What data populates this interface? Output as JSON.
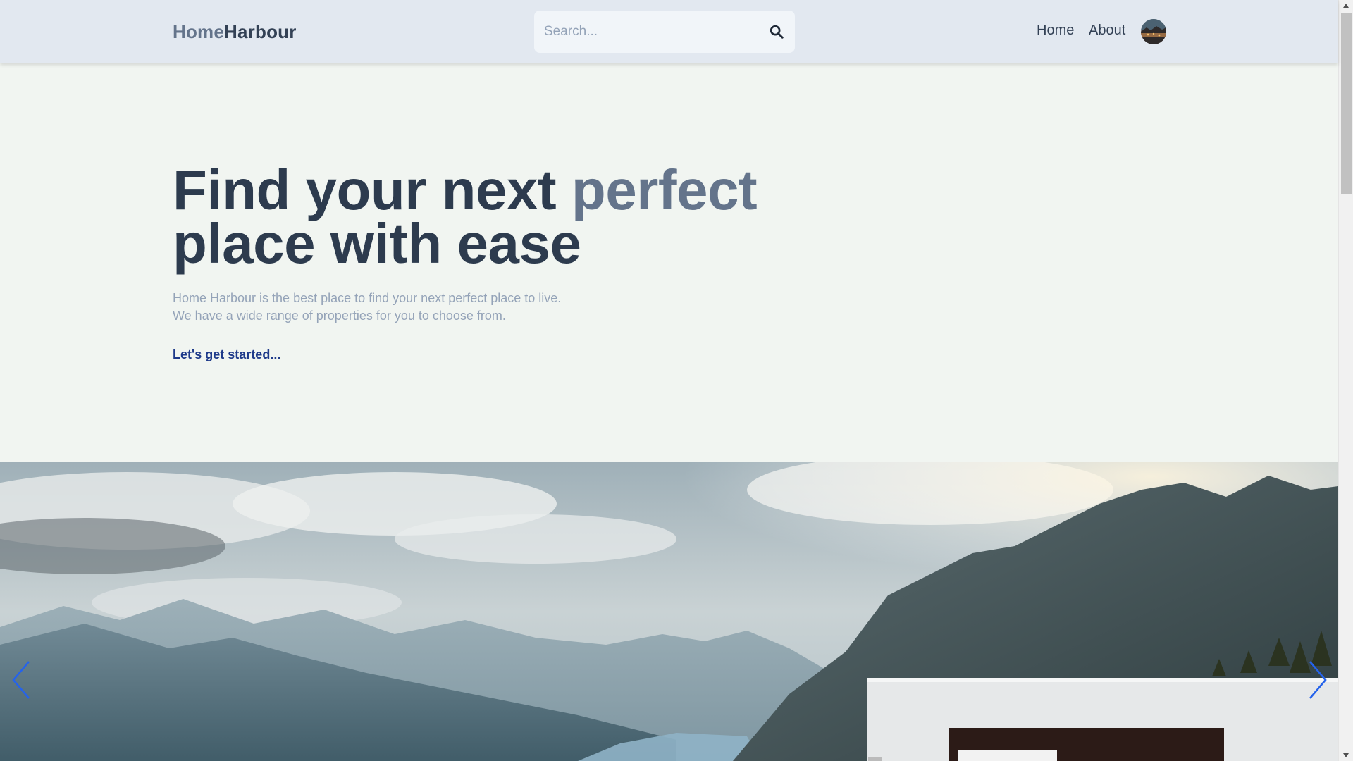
{
  "header": {
    "logo_part1": "Home",
    "logo_part2": "Harbour",
    "search_placeholder": "Search...",
    "search_icon": "search-icon",
    "nav": [
      {
        "label": "Home"
      },
      {
        "label": "About"
      }
    ],
    "avatar_icon": "user-avatar"
  },
  "hero": {
    "title_line1_plain": "Find your next ",
    "title_line1_accent": "perfect",
    "title_line2": "place with ease",
    "desc_line1": "Home Harbour is the best place to find your next perfect place to live.",
    "desc_line2": "We have a wide range of properties for you to choose from.",
    "cta": "Let's get started..."
  },
  "carousel": {
    "prev_icon": "chevron-left-icon",
    "next_icon": "chevron-right-icon"
  },
  "colors": {
    "header_bg": "#e2e8f0",
    "page_bg": "#f1f5f1",
    "title": "#2d3b4e",
    "accent": "#64748b",
    "cta": "#1e3a8a",
    "arrows": "#2563eb"
  }
}
